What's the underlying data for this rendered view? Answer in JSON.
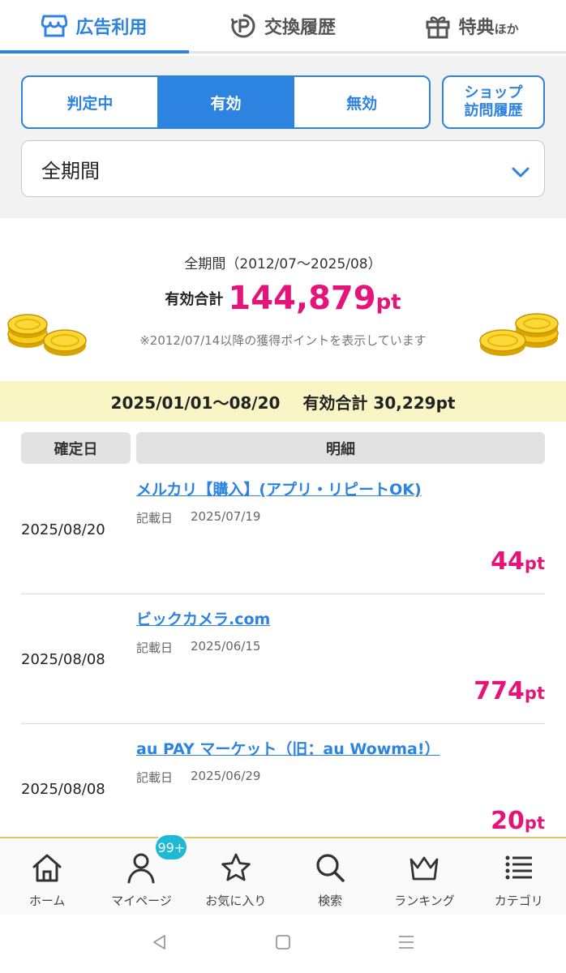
{
  "top_tabs": [
    {
      "label": "広告利用",
      "icon": "store-icon",
      "active": true
    },
    {
      "label": "交換履歴",
      "icon": "point-exchange-icon",
      "active": false
    },
    {
      "label": "特典",
      "label_small": "ほか",
      "icon": "gift-icon",
      "active": false
    }
  ],
  "filter": {
    "segments": [
      {
        "label": "判定中",
        "active": false
      },
      {
        "label": "有効",
        "active": true
      },
      {
        "label": "無効",
        "active": false
      }
    ],
    "shop_history": {
      "line1": "ショップ",
      "line2": "訪問履歴"
    },
    "period_select": {
      "value": "全期間",
      "icon": "chevron-down-icon"
    }
  },
  "summary": {
    "range": "全期間（2012/07〜2025/08）",
    "total_label": "有効合計",
    "total_value": "144,879",
    "total_unit": "pt",
    "note": "※2012/07/14以降の獲得ポイントを表示しています"
  },
  "year_band": {
    "range": "2025/01/01〜08/20",
    "total": "有効合計 30,229pt"
  },
  "table": {
    "headers": {
      "date": "確定日",
      "detail": "明細"
    },
    "rows": [
      {
        "date": "2025/08/20",
        "title": "メルカリ【購入】(アプリ・リピートOK)",
        "record_label": "記載日",
        "record_date": "2025/07/19",
        "points": "44",
        "unit": "pt"
      },
      {
        "date": "2025/08/08",
        "title": "ビックカメラ.com",
        "record_label": "記載日",
        "record_date": "2025/06/15",
        "points": "774",
        "unit": "pt"
      },
      {
        "date": "2025/08/08",
        "title": "au PAY マーケット（旧：au Wowma!）",
        "record_label": "記載日",
        "record_date": "2025/06/29",
        "points": "20",
        "unit": "pt"
      }
    ]
  },
  "bottom_nav": [
    {
      "label": "ホーム",
      "icon": "home-icon"
    },
    {
      "label": "マイページ",
      "icon": "user-icon",
      "badge": "99+"
    },
    {
      "label": "お気に入り",
      "icon": "star-icon"
    },
    {
      "label": "検索",
      "icon": "search-icon"
    },
    {
      "label": "ランキング",
      "icon": "crown-icon"
    },
    {
      "label": "カテゴリ",
      "icon": "list-icon"
    }
  ],
  "colors": {
    "accent": "#2c83e0",
    "points": "#e5147a",
    "year_band": "#faf5c4",
    "badge": "#1fb9d3"
  }
}
